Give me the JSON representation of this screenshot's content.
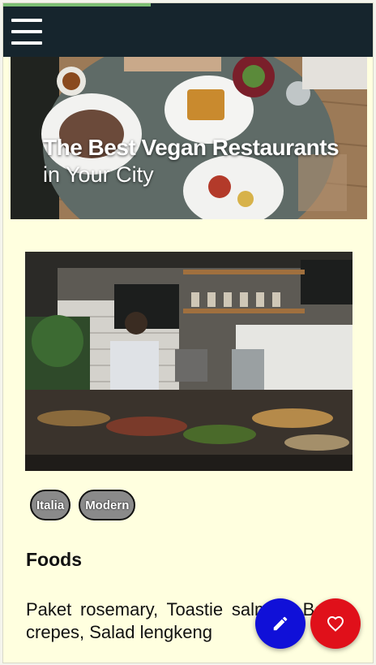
{
  "progress": {
    "value": 0.4
  },
  "topbar": {
    "menu_icon": "hamburger-icon"
  },
  "hero": {
    "title": "The Best Vegan Restaurants",
    "subtitle": "in Your City",
    "image": "restaurant-table-photo"
  },
  "article": {
    "image": "restaurant-kitchen-photo",
    "tags": [
      "Italia",
      "Modern"
    ],
    "section_title": "Foods",
    "body": "Paket rosemary, Toastie salmon, Bebek crepes, Salad lengkeng"
  },
  "fabs": {
    "edit_icon": "pencil-icon",
    "like_icon": "heart-icon"
  },
  "colors": {
    "topbar": "#16252d",
    "page_background": "#ffffdf",
    "progress": "#7cbf73",
    "edit_button": "#1010d8",
    "like_button": "#e0101a",
    "tag_background": "#8a8a8a"
  }
}
